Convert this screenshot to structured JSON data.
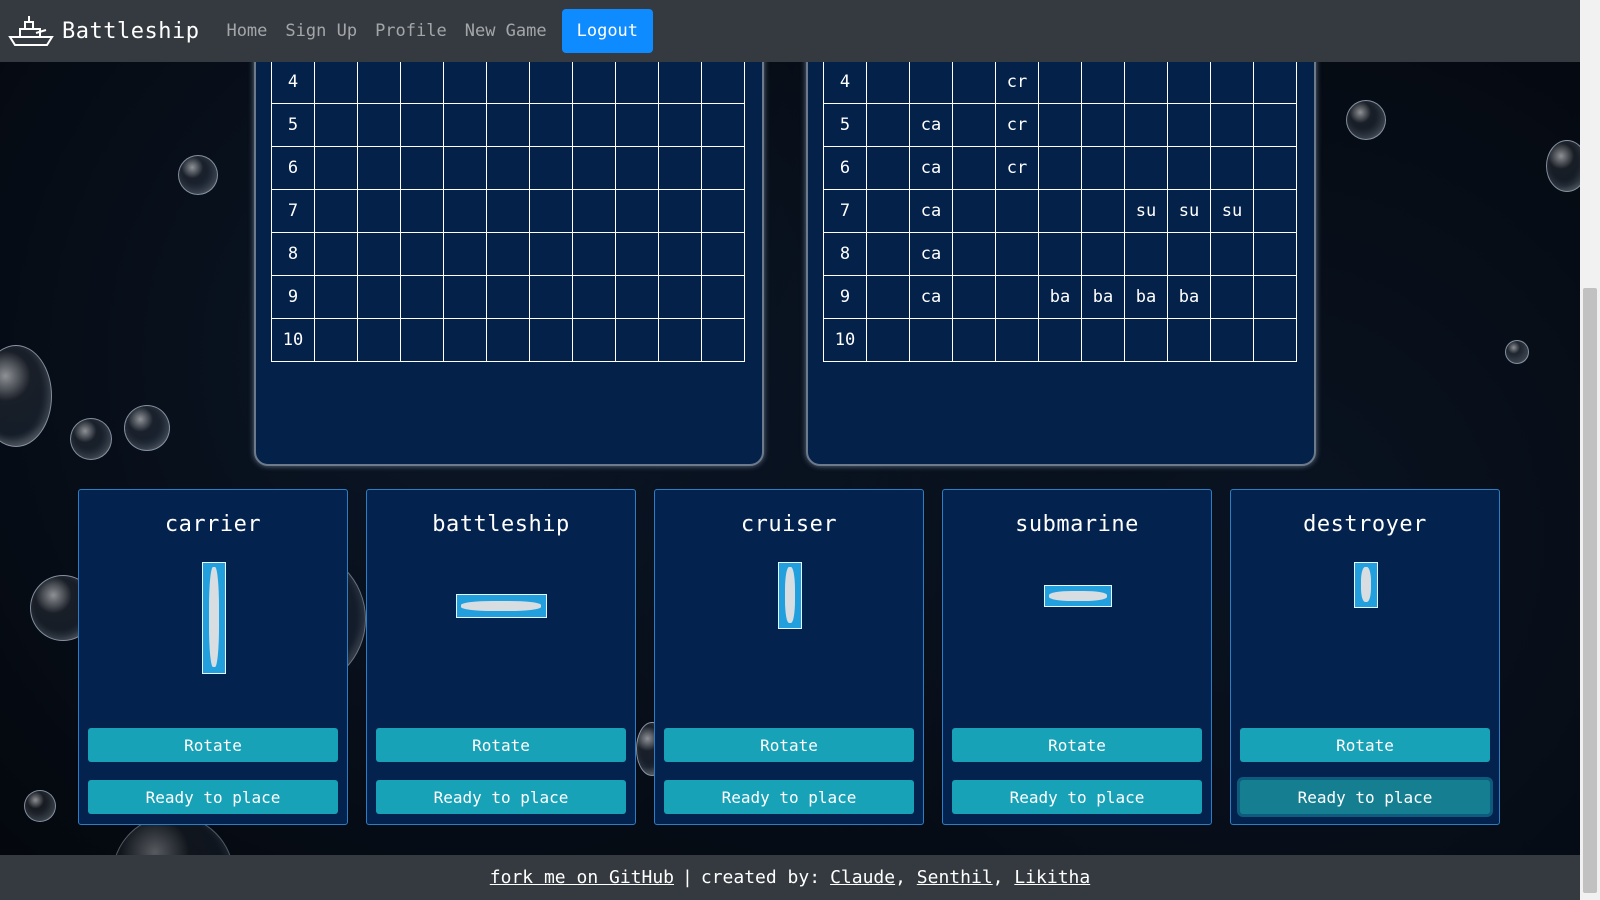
{
  "nav": {
    "brand": "Battleship",
    "links": [
      "Home",
      "Sign Up",
      "Profile",
      "New Game"
    ],
    "logout": "Logout"
  },
  "boards": {
    "left": {
      "rows": [
        {
          "label": "4",
          "cells": [
            "",
            "",
            "",
            "",
            "",
            "",
            "",
            "",
            "",
            ""
          ]
        },
        {
          "label": "5",
          "cells": [
            "",
            "",
            "",
            "",
            "",
            "",
            "",
            "",
            "",
            ""
          ]
        },
        {
          "label": "6",
          "cells": [
            "",
            "",
            "",
            "",
            "",
            "",
            "",
            "",
            "",
            ""
          ]
        },
        {
          "label": "7",
          "cells": [
            "",
            "",
            "",
            "",
            "",
            "",
            "",
            "",
            "",
            ""
          ]
        },
        {
          "label": "8",
          "cells": [
            "",
            "",
            "",
            "",
            "",
            "",
            "",
            "",
            "",
            ""
          ]
        },
        {
          "label": "9",
          "cells": [
            "",
            "",
            "",
            "",
            "",
            "",
            "",
            "",
            "",
            ""
          ]
        },
        {
          "label": "10",
          "cells": [
            "",
            "",
            "",
            "",
            "",
            "",
            "",
            "",
            "",
            ""
          ]
        }
      ]
    },
    "right": {
      "rows": [
        {
          "label": "4",
          "cells": [
            "",
            "",
            "",
            "cr",
            "",
            "",
            "",
            "",
            "",
            ""
          ]
        },
        {
          "label": "5",
          "cells": [
            "",
            "ca",
            "",
            "cr",
            "",
            "",
            "",
            "",
            "",
            ""
          ]
        },
        {
          "label": "6",
          "cells": [
            "",
            "ca",
            "",
            "cr",
            "",
            "",
            "",
            "",
            "",
            ""
          ]
        },
        {
          "label": "7",
          "cells": [
            "",
            "ca",
            "",
            "",
            "",
            "",
            "su",
            "su",
            "su",
            ""
          ]
        },
        {
          "label": "8",
          "cells": [
            "",
            "ca",
            "",
            "",
            "",
            "",
            "",
            "",
            "",
            ""
          ]
        },
        {
          "label": "9",
          "cells": [
            "",
            "ca",
            "",
            "",
            "ba",
            "ba",
            "ba",
            "ba",
            "",
            ""
          ]
        },
        {
          "label": "10",
          "cells": [
            "",
            "",
            "",
            "",
            "",
            "",
            "",
            "",
            "",
            ""
          ]
        }
      ]
    }
  },
  "ships": [
    {
      "name": "carrier",
      "rotate": "Rotate",
      "ready": "Ready to place"
    },
    {
      "name": "battleship",
      "rotate": "Rotate",
      "ready": "Ready to place"
    },
    {
      "name": "cruiser",
      "rotate": "Rotate",
      "ready": "Ready to place"
    },
    {
      "name": "submarine",
      "rotate": "Rotate",
      "ready": "Ready to place"
    },
    {
      "name": "destroyer",
      "rotate": "Rotate",
      "ready": "Ready to place"
    }
  ],
  "footer": {
    "github": "fork me on GitHub",
    "created_by": "created by:",
    "authors": [
      "Claude",
      "Senthil",
      "Likitha"
    ]
  },
  "colors": {
    "navbar": "#343a40",
    "logout": "#0d8bff",
    "panel": "#04214a",
    "button": "#18a2b8"
  }
}
